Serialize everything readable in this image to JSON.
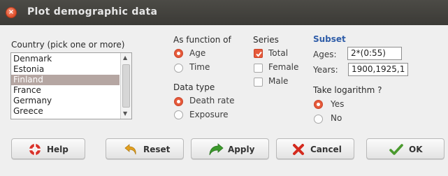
{
  "window": {
    "title": "Plot demographic data"
  },
  "country": {
    "label": "Country (pick one or more)",
    "items": [
      "Denmark",
      "Estonia",
      "Finland",
      "France",
      "Germany",
      "Greece"
    ],
    "selected": "Finland"
  },
  "as_function_of": {
    "label": "As function of",
    "options": [
      "Age",
      "Time"
    ],
    "selected": "Age"
  },
  "data_type": {
    "label": "Data type",
    "options": [
      "Death rate",
      "Exposure"
    ],
    "selected": "Death rate"
  },
  "series": {
    "label": "Series",
    "options": [
      "Total",
      "Female",
      "Male"
    ],
    "checked": [
      "Total"
    ]
  },
  "subset": {
    "label": "Subset",
    "ages_label": "Ages:",
    "ages_value": "2*(0:55)",
    "years_label": "Years:",
    "years_value": "1900,1925,1"
  },
  "logarithm": {
    "label": "Take logarithm ?",
    "options": [
      "Yes",
      "No"
    ],
    "selected": "Yes"
  },
  "buttons": {
    "help": "Help",
    "reset": "Reset",
    "apply": "Apply",
    "cancel": "Cancel",
    "ok": "OK"
  },
  "icons": {
    "close": "close-icon",
    "help": "lifebuoy-icon",
    "reset": "undo-arrow-icon",
    "apply": "forward-arrow-icon",
    "cancel": "x-cross-icon",
    "ok": "checkmark-icon"
  },
  "colors": {
    "titlebar": "#3f3e39",
    "accent": "#e65a3a",
    "selection": "#b5a6a2",
    "subset_heading": "#2f5da8"
  }
}
